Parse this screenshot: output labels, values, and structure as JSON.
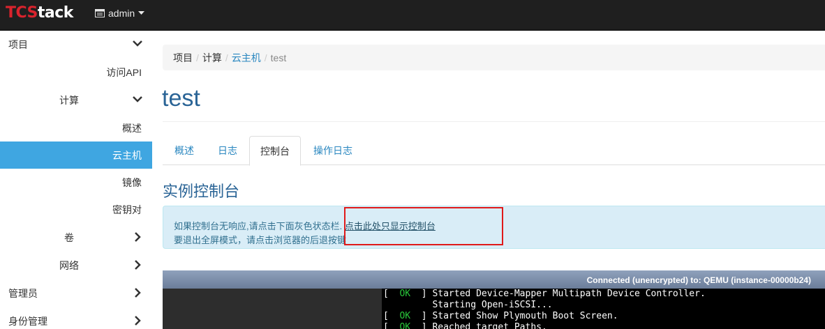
{
  "app": {
    "brand_part1": "TCS",
    "brand_part2": "tack",
    "project_menu": "admin"
  },
  "sidebar": {
    "items": [
      {
        "label": "项目"
      },
      {
        "label": "访问API"
      },
      {
        "label": "计算"
      },
      {
        "label": "概述"
      },
      {
        "label": "云主机"
      },
      {
        "label": "镜像"
      },
      {
        "label": "密钥对"
      },
      {
        "label": "卷"
      },
      {
        "label": "网络"
      },
      {
        "label": "管理员"
      },
      {
        "label": "身份管理"
      }
    ]
  },
  "breadcrumb": {
    "items": [
      "项目",
      "计算",
      "云主机",
      "test"
    ],
    "separator": "/"
  },
  "page": {
    "title": "test"
  },
  "tabs": [
    {
      "label": "概述"
    },
    {
      "label": "日志"
    },
    {
      "label": "控制台"
    },
    {
      "label": "操作日志"
    }
  ],
  "console": {
    "section_title": "实例控制台",
    "info_text": "如果控制台无响应,请点击下面灰色状态栏.",
    "info_link": "点击此处只显示控制台",
    "info_line2": "要退出全屏模式，请点击浏览器的后退按键",
    "status": "Connected (unencrypted) to: QEMU (instance-00000b24)",
    "lines": [
      {
        "bracket_open": "[  ",
        "ok": "OK",
        "bracket_close": "  ] ",
        "text": "Started Device-Mapper Multipath Device Controller."
      },
      {
        "bracket_open": "",
        "ok": "",
        "bracket_close": "",
        "text": "         Starting Open-iSCSI..."
      },
      {
        "bracket_open": "[  ",
        "ok": "OK",
        "bracket_close": "  ] ",
        "text": "Started Show Plymouth Boot Screen."
      },
      {
        "bracket_open": "[  ",
        "ok": "OK",
        "bracket_close": "  ] ",
        "text": "Reached target Paths."
      }
    ]
  },
  "colors": {
    "accent": "#3fa6e1",
    "link": "#2a87c0",
    "highlight": "#e01a1a",
    "ok": "#29c83a"
  }
}
